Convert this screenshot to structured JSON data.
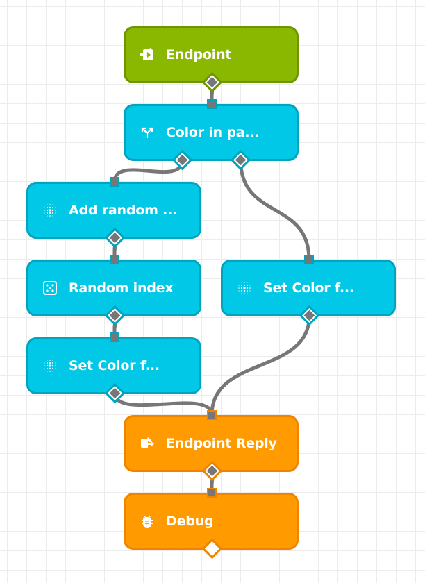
{
  "colors": {
    "trigger": "#8ab800",
    "function": "#00c8e6",
    "output": "#ff9b00",
    "wire": "#777777",
    "grid": "#ececec"
  },
  "nodes": [
    {
      "id": "endpoint",
      "label": "Endpoint",
      "icon": "endpoint-in-icon",
      "kind": "trigger"
    },
    {
      "id": "color-in-payload",
      "label": "Color in pa...",
      "icon": "split-icon",
      "kind": "function"
    },
    {
      "id": "add-random",
      "label": "Add random ...",
      "icon": "function-dots-icon",
      "kind": "function"
    },
    {
      "id": "random-index",
      "label": "Random index",
      "icon": "dice-icon",
      "kind": "function"
    },
    {
      "id": "set-color-left",
      "label": "Set Color f...",
      "icon": "function-dots-icon",
      "kind": "function"
    },
    {
      "id": "set-color-right",
      "label": "Set Color f...",
      "icon": "function-dots-icon",
      "kind": "function"
    },
    {
      "id": "endpoint-reply",
      "label": "Endpoint Reply",
      "icon": "endpoint-reply-icon",
      "kind": "output"
    },
    {
      "id": "debug",
      "label": "Debug",
      "icon": "bug-icon",
      "kind": "output"
    }
  ],
  "connections": [
    {
      "from": "endpoint",
      "out": 0,
      "to": "color-in-payload"
    },
    {
      "from": "color-in-payload",
      "out": 0,
      "to": "add-random"
    },
    {
      "from": "color-in-payload",
      "out": 1,
      "to": "set-color-right"
    },
    {
      "from": "add-random",
      "out": 0,
      "to": "random-index"
    },
    {
      "from": "random-index",
      "out": 0,
      "to": "set-color-left"
    },
    {
      "from": "set-color-left",
      "out": 0,
      "to": "endpoint-reply"
    },
    {
      "from": "set-color-right",
      "out": 0,
      "to": "endpoint-reply"
    },
    {
      "from": "endpoint-reply",
      "out": 0,
      "to": "debug"
    }
  ]
}
